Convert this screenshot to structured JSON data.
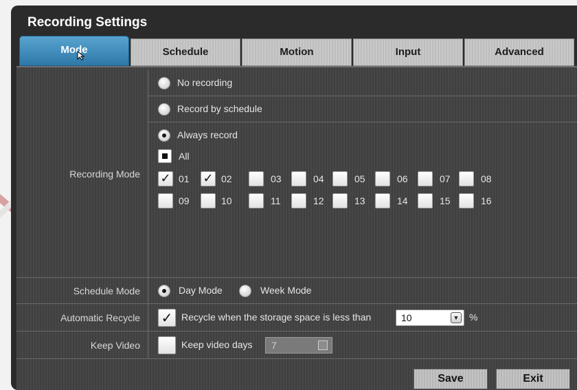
{
  "window": {
    "title": "Recording Settings"
  },
  "tabs": [
    {
      "label": "Mode",
      "active": true
    },
    {
      "label": "Schedule",
      "active": false
    },
    {
      "label": "Motion",
      "active": false
    },
    {
      "label": "Input",
      "active": false
    },
    {
      "label": "Advanced",
      "active": false
    }
  ],
  "recording_mode": {
    "label": "Recording Mode",
    "options": {
      "none": "No recording",
      "schedule": "Record by schedule",
      "always": "Always record"
    },
    "selected": "always",
    "all_label": "All",
    "channels": [
      "01",
      "02",
      "03",
      "04",
      "05",
      "06",
      "07",
      "08",
      "09",
      "10",
      "11",
      "12",
      "13",
      "14",
      "15",
      "16"
    ],
    "checked_channels": [
      "01",
      "02"
    ]
  },
  "schedule_mode": {
    "label": "Schedule Mode",
    "day": "Day Mode",
    "week": "Week Mode",
    "selected": "day"
  },
  "automatic_recycle": {
    "label": "Automatic Recycle",
    "text": "Recycle when the storage space is less than",
    "value": "10",
    "unit": "%",
    "checked": true
  },
  "keep_video": {
    "label": "Keep Video",
    "text": "Keep video days",
    "value": "7",
    "checked": false
  },
  "buttons": {
    "save": "Save",
    "exit": "Exit"
  },
  "colors": {
    "active_tab": "#2e78a8",
    "panel": "#444444",
    "watermark": "#b03a3a"
  }
}
